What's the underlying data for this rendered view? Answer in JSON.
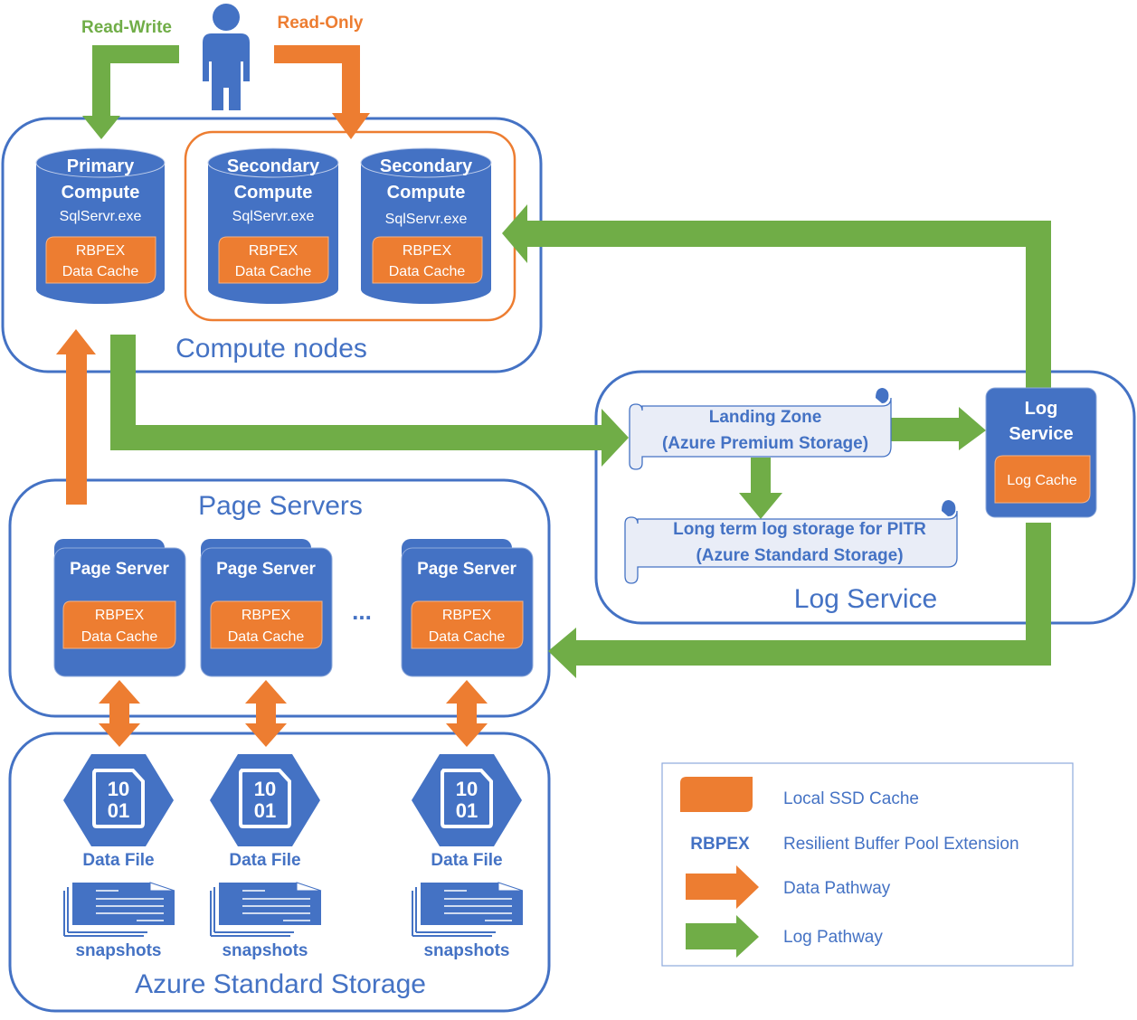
{
  "colors": {
    "blue": "#4472C4",
    "orange": "#ED7D31",
    "green": "#70AD47",
    "scroll_fill": "#E9EDF7"
  },
  "user": {
    "read_write_label": "Read-Write",
    "read_only_label": "Read-Only",
    "icon": "person-icon"
  },
  "compute_nodes": {
    "title": "Compute nodes",
    "nodes": [
      {
        "line1": "Primary",
        "line2": "Compute",
        "process": "SqlServr.exe",
        "cache_line1": "RBPEX",
        "cache_line2": "Data Cache"
      },
      {
        "line1": "Secondary",
        "line2": "Compute",
        "process": "SqlServr.exe",
        "cache_line1": "RBPEX",
        "cache_line2": "Data Cache"
      },
      {
        "line1": "Secondary",
        "line2": "Compute",
        "process": "SqlServr.exe",
        "cache_line1": "RBPEX",
        "cache_line2": "Data Cache"
      }
    ]
  },
  "log_service": {
    "title": "Log Service",
    "landing_zone_line1": "Landing Zone",
    "landing_zone_line2": "(Azure Premium Storage)",
    "long_term_line1": "Long term log storage for PITR",
    "long_term_line2": "(Azure Standard Storage)",
    "service_line1": "Log",
    "service_line2": "Service",
    "cache_label": "Log Cache"
  },
  "page_servers": {
    "title": "Page Servers",
    "ellipsis": "...",
    "servers": [
      {
        "title": "Page Server",
        "cache_line1": "RBPEX",
        "cache_line2": "Data Cache"
      },
      {
        "title": "Page Server",
        "cache_line1": "RBPEX",
        "cache_line2": "Data Cache"
      },
      {
        "title": "Page Server",
        "cache_line1": "RBPEX",
        "cache_line2": "Data Cache"
      }
    ]
  },
  "storage": {
    "title": "Azure Standard Storage",
    "items": [
      {
        "file_icon_top": "10",
        "file_icon_bottom": "01",
        "file_label": "Data File",
        "snapshot_label": "snapshots"
      },
      {
        "file_icon_top": "10",
        "file_icon_bottom": "01",
        "file_label": "Data File",
        "snapshot_label": "snapshots"
      },
      {
        "file_icon_top": "10",
        "file_icon_bottom": "01",
        "file_label": "Data File",
        "snapshot_label": "snapshots"
      }
    ]
  },
  "legend": {
    "items": [
      {
        "key": "swatch",
        "label": "Local SSD Cache"
      },
      {
        "key": "RBPEX",
        "label": "Resilient Buffer Pool Extension"
      },
      {
        "key": "orange-arrow",
        "label": "Data Pathway"
      },
      {
        "key": "green-arrow",
        "label": "Log Pathway"
      }
    ]
  }
}
